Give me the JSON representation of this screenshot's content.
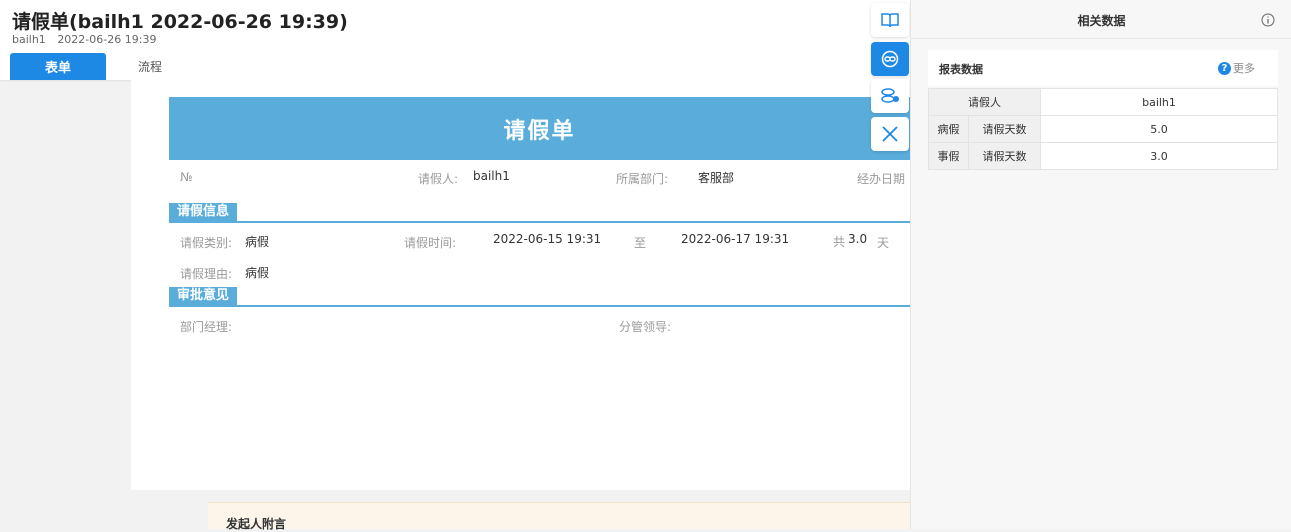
{
  "header": {
    "title": "请假单(bailh1 2022-06-26 19:39)",
    "user": "bailh1",
    "datetime": "2022-06-26 19:39",
    "tabs": {
      "form": "表单",
      "flow": "流程"
    }
  },
  "form": {
    "title": "请假单",
    "no_label": "№",
    "applicant_label": "请假人:",
    "applicant_value": "bailh1",
    "department_label": "所属部门:",
    "department_value": "客服部",
    "handling_date_label": "经办日期",
    "leave_section": "请假信息",
    "leave_type_label": "请假类别:",
    "leave_type_value": "病假",
    "leave_time_label": "请假时间:",
    "start_time": "2022-06-15 19:31",
    "to_label": "至",
    "end_time": "2022-06-17 19:31",
    "total_prefix": "共",
    "total_value": "3.0",
    "total_unit": "天",
    "reason_label": "请假理由:",
    "reason_value": "病假",
    "approval_section": "审批意见",
    "dept_manager_label": "部门经理:",
    "supervisor_label": "分管领导:",
    "initiator_note": "发起人附言"
  },
  "panel": {
    "title": "相关数据",
    "report_title": "报表数据",
    "more": "更多",
    "table": {
      "applicant_header": "请假人",
      "applicant_value": "bailh1",
      "rows": [
        {
          "type": "病假",
          "metric": "请假天数",
          "value": "5.0"
        },
        {
          "type": "事假",
          "metric": "请假天数",
          "value": "3.0"
        }
      ]
    }
  },
  "colors": {
    "primary": "#1e88e5",
    "form_accent": "#5aaddb"
  },
  "icons": [
    "book-icon",
    "link-icon",
    "people-link-icon",
    "close-icon",
    "info-icon",
    "help-icon"
  ]
}
